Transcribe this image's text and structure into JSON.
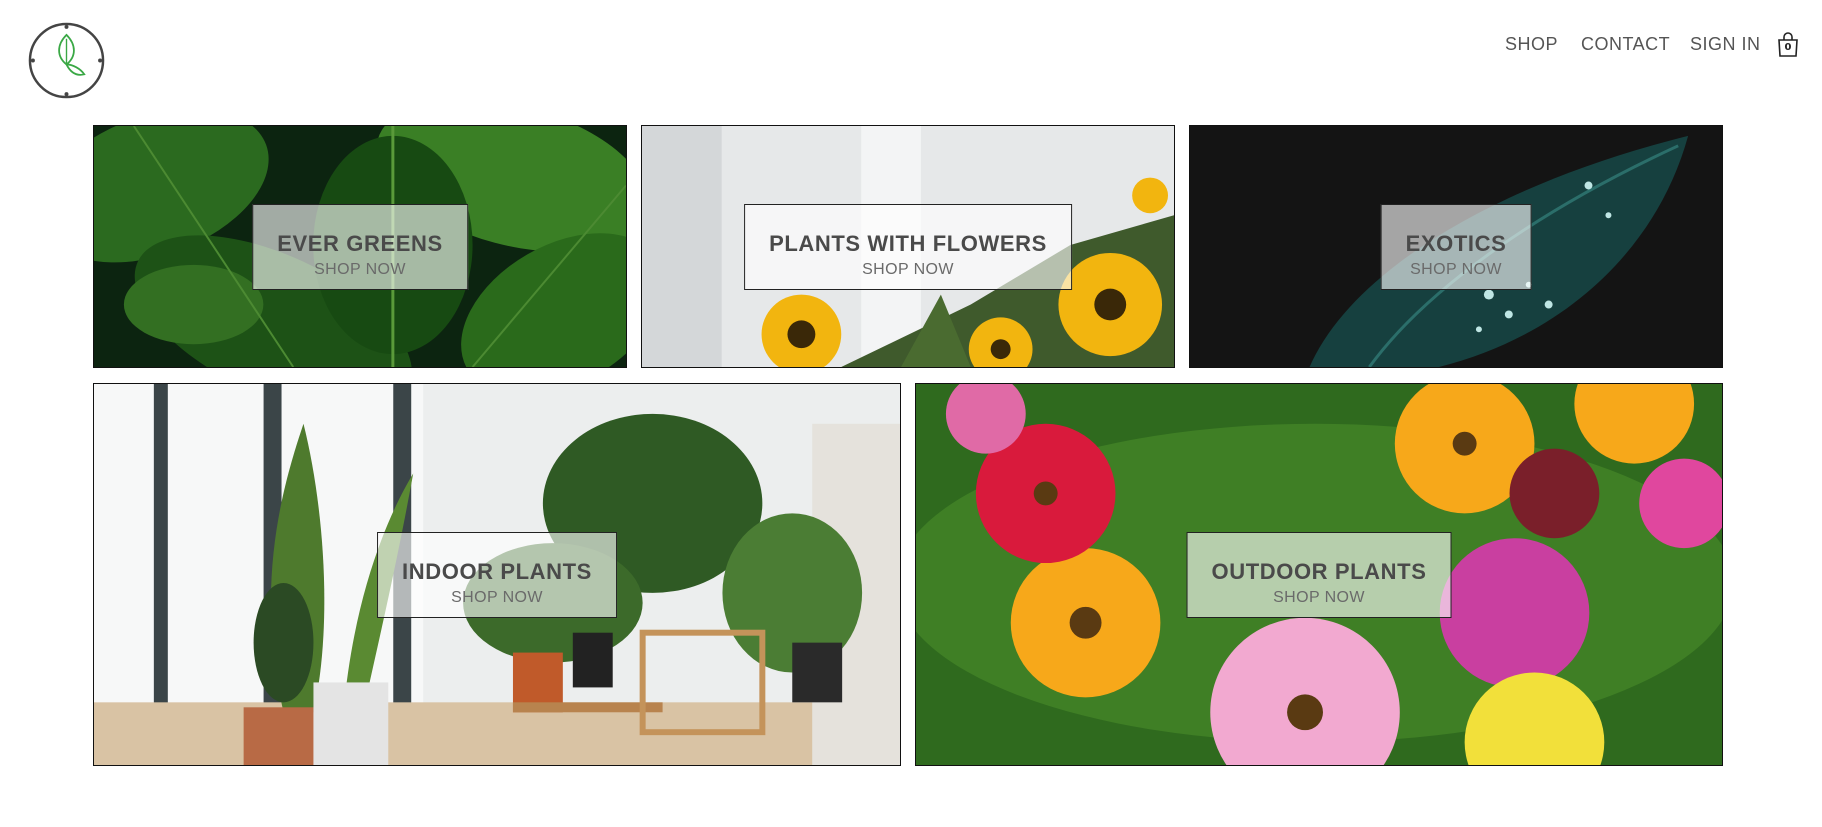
{
  "header": {
    "logo_icon": "leaf-clock-logo",
    "nav": {
      "shop": "SHOP",
      "contact": "CONTACT",
      "sign_in": "SIGN IN"
    },
    "cart": {
      "icon": "shopping-bag-icon",
      "count": "0"
    }
  },
  "categories": [
    {
      "title": "EVER GREENS",
      "cta": "SHOP NOW"
    },
    {
      "title": "PLANTS WITH FLOWERS",
      "cta": "SHOP NOW"
    },
    {
      "title": "EXOTICS",
      "cta": "SHOP NOW"
    },
    {
      "title": "INDOOR PLANTS",
      "cta": "SHOP NOW"
    },
    {
      "title": "OUTDOOR PLANTS",
      "cta": "SHOP NOW"
    }
  ],
  "colors": {
    "accent_green": "#3aa845",
    "border": "#111111",
    "text": "#4a4a4a"
  }
}
